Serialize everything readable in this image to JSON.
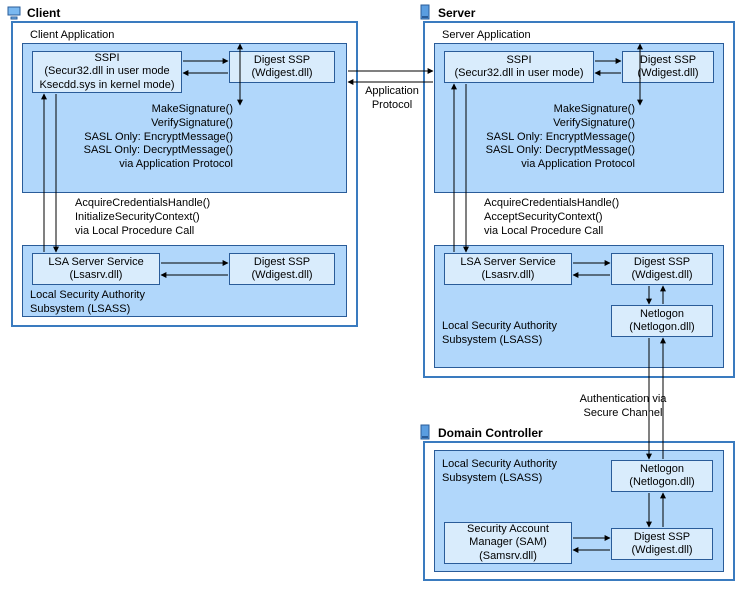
{
  "client": {
    "title": "Client",
    "app": {
      "title": "Client Application",
      "sspi": {
        "name": "SSPI",
        "detail1": "(Secur32.dll in user mode",
        "detail2": "Ksecdd.sys in kernel mode)"
      },
      "digest": {
        "name": "Digest SSP",
        "detail": "(Wdigest.dll)"
      },
      "sig": {
        "l1": "MakeSignature()",
        "l2": "VerifySignature()",
        "l3": "SASL Only: EncryptMessage()",
        "l4": "SASL Only: DecryptMessage()",
        "l5": "via Application Protocol"
      },
      "cred": {
        "l1": "AcquireCredentialsHandle()",
        "l2": "InitializeSecurityContext()",
        "l3": "via Local Procedure Call"
      }
    },
    "lsass": {
      "title1": "Local Security Authority",
      "title2": "Subsystem (LSASS)",
      "lsa": {
        "name": "LSA Server Service",
        "detail": "(Lsasrv.dll)"
      },
      "digest": {
        "name": "Digest SSP",
        "detail": "(Wdigest.dll)"
      }
    }
  },
  "server": {
    "title": "Server",
    "app": {
      "title": "Server Application",
      "sspi": {
        "name": "SSPI",
        "detail": "(Secur32.dll in user mode)"
      },
      "digest": {
        "name": "Digest SSP",
        "detail": "(Wdigest.dll)"
      },
      "sig": {
        "l1": "MakeSignature()",
        "l2": "VerifySignature()",
        "l3": "SASL Only: EncryptMessage()",
        "l4": "SASL Only: DecryptMessage()",
        "l5": "via Application Protocol"
      },
      "cred": {
        "l1": "AcquireCredentialsHandle()",
        "l2": "AcceptSecurityContext()",
        "l3": "via Local Procedure Call"
      }
    },
    "lsass": {
      "title1": "Local Security Authority",
      "title2": "Subsystem (LSASS)",
      "lsa": {
        "name": "LSA Server Service",
        "detail": "(Lsasrv.dll)"
      },
      "digest": {
        "name": "Digest SSP",
        "detail": "(Wdigest.dll)"
      },
      "netlogon": {
        "name": "Netlogon",
        "detail": "(Netlogon.dll)"
      }
    }
  },
  "dc": {
    "title": "Domain Controller",
    "lsass": {
      "title1": "Local Security Authority",
      "title2": "Subsystem (LSASS)",
      "sam": {
        "name1": "Security Account",
        "name2": "Manager (SAM)",
        "detail": "(Samsrv.dll)"
      },
      "digest": {
        "name": "Digest SSP",
        "detail": "(Wdigest.dll)"
      },
      "netlogon": {
        "name": "Netlogon",
        "detail": "(Netlogon.dll)"
      }
    }
  },
  "links": {
    "app_protocol": {
      "l1": "Application",
      "l2": "Protocol"
    },
    "auth_channel": {
      "l1": "Authentication via",
      "l2": "Secure Channel"
    }
  }
}
